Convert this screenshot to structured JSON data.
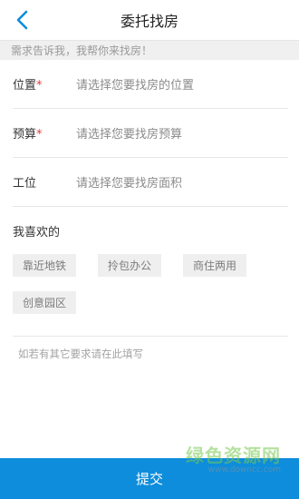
{
  "header": {
    "title": "委托找房",
    "back_icon": "chevron-left-icon"
  },
  "hint": "需求告诉我，我帮你来找房！",
  "form": [
    {
      "key": "location",
      "label": "位置",
      "required": true,
      "placeholder": "请选择您要找房的位置"
    },
    {
      "key": "budget",
      "label": "预算",
      "required": true,
      "placeholder": "请选择您要找房预算"
    },
    {
      "key": "workstation",
      "label": "工位",
      "required": false,
      "placeholder": "请选择您要找房面积"
    }
  ],
  "preferences": {
    "title": "我喜欢的",
    "tags": [
      "靠近地铁",
      "拎包办公",
      "商住两用",
      "创意园区"
    ]
  },
  "remark_placeholder": "如若有其它要求请在此填写",
  "submit_label": "提交",
  "watermark": {
    "main": "绿色资源网",
    "sub": "www.downcc.com"
  },
  "colors": {
    "accent": "#0d8ddb",
    "required": "#e53935",
    "tag_bg": "#efefef"
  }
}
